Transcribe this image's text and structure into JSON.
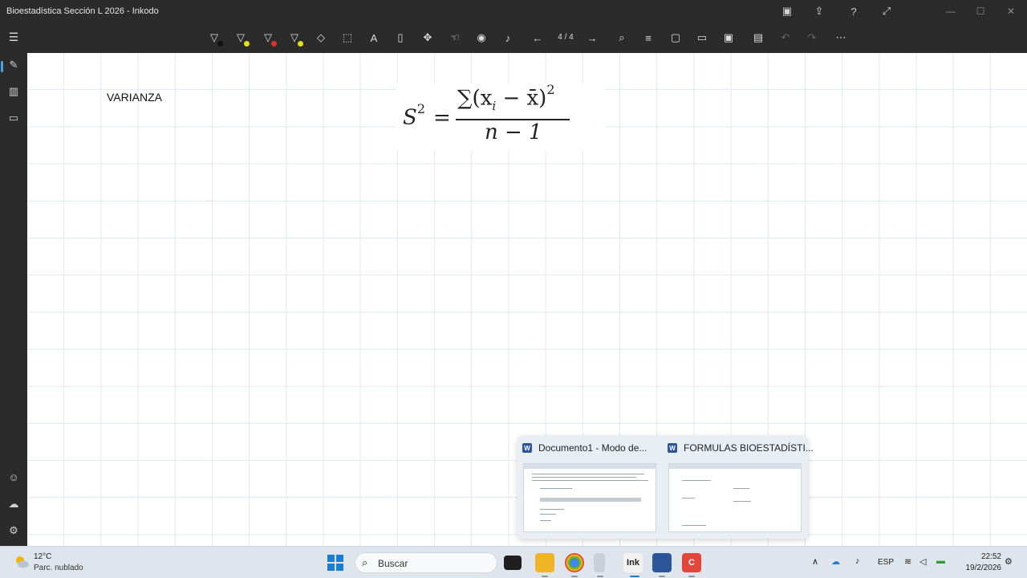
{
  "window": {
    "title": "Bioestadística Sección L 2026 - Inkodo"
  },
  "toolbar": {
    "page_indicator": "4 / 4",
    "pens": [
      {
        "name": "pen-black",
        "color": "#111111"
      },
      {
        "name": "pen-yellow",
        "color": "#e6e01a"
      },
      {
        "name": "pen-red",
        "color": "#d9322f"
      },
      {
        "name": "highlighter-yellow",
        "color": "#e6e01a"
      }
    ]
  },
  "canvas": {
    "label": "VARIANZA",
    "formula": {
      "lhs": "S",
      "lhs_exp": "2",
      "equals": "=",
      "numerator": "∑(x",
      "sub": "i",
      "numerator_mid": " − x̄)",
      "numerator_exp": "2",
      "denominator": "n − 1"
    }
  },
  "thumbnails": [
    {
      "title": "Documento1  -  Modo de..."
    },
    {
      "title": "FORMULAS BIOESTADÍSTI..."
    }
  ],
  "taskbar": {
    "weather_temp": "12°C",
    "weather_desc": "Parc. nublado",
    "search_placeholder": "Buscar",
    "language": "ESP",
    "time": "22:52",
    "date": "19/2/2026"
  }
}
